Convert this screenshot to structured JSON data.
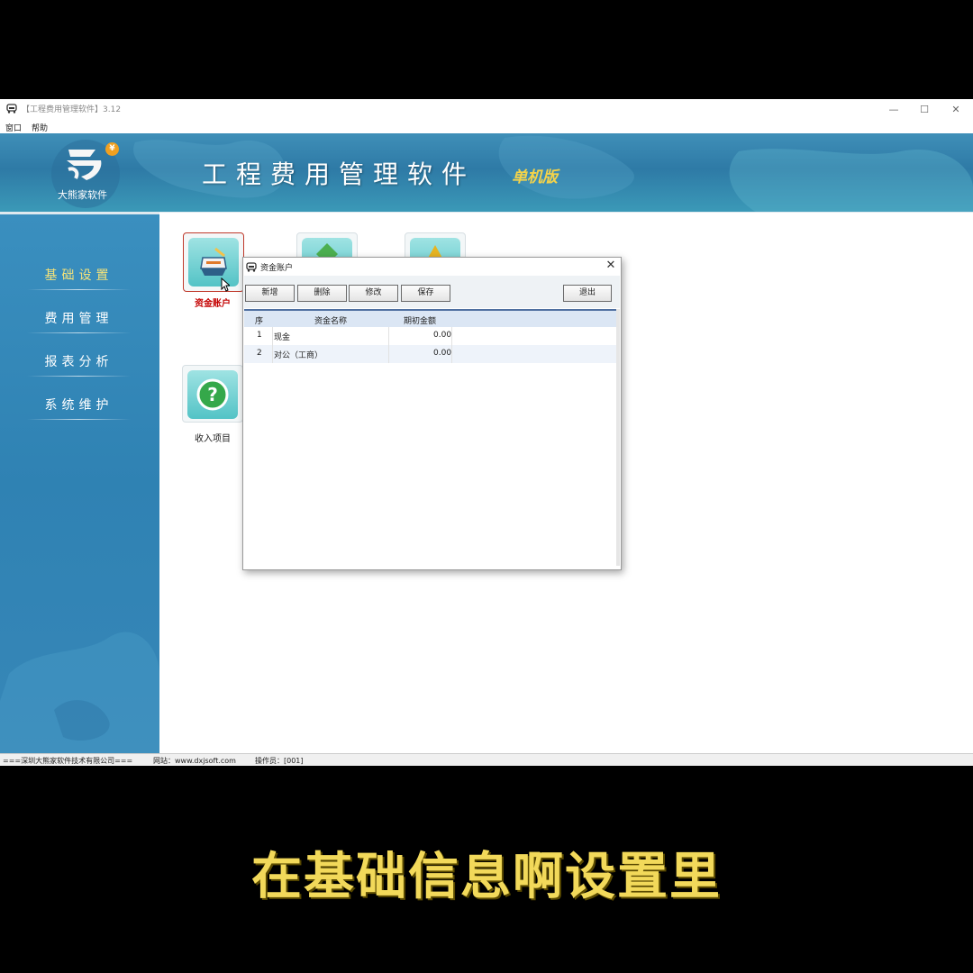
{
  "window": {
    "title": "【工程费用管理软件】3.12",
    "controls": {
      "minimize": "—",
      "maximize": "☐",
      "close": "✕"
    }
  },
  "menu": [
    "窗口",
    "帮助"
  ],
  "banner": {
    "logo_text": "大熊家软件",
    "logo_badge": "¥",
    "title": "工程费用管理软件",
    "edition": "单机版"
  },
  "sidebar": {
    "items": [
      {
        "label": "基础设置",
        "active": true
      },
      {
        "label": "费用管理",
        "active": false
      },
      {
        "label": "报表分析",
        "active": false
      },
      {
        "label": "系统维护",
        "active": false
      }
    ]
  },
  "tiles": [
    {
      "label": "资金账户",
      "icon": "account-icon",
      "selected": true
    },
    {
      "label": "",
      "icon": "green-diamond-icon",
      "selected": false
    },
    {
      "label": "",
      "icon": "warning-icon",
      "selected": false
    },
    {
      "label": "收入项目",
      "icon": "question-icon",
      "selected": false
    }
  ],
  "dialog": {
    "title": "资金账户",
    "buttons": {
      "add": "新增",
      "delete": "删除",
      "edit": "修改",
      "save": "保存",
      "exit": "退出"
    },
    "columns": [
      "序",
      "资金名称",
      "期初金额"
    ],
    "rows": [
      {
        "no": "1",
        "name": "现金",
        "amount": "0.00"
      },
      {
        "no": "2",
        "name": "对公（工商）",
        "amount": "0.00"
      }
    ]
  },
  "statusbar": {
    "company": "===深圳大熊家软件技术有限公司===",
    "website": "网站：www.dxjsoft.com",
    "operator": "操作员：[001]"
  },
  "subtitle": "在基础信息啊设置里",
  "colors": {
    "banner": "#2e7aa6",
    "sidebar": "#3a8fbf",
    "subtitle": "#f2d95a",
    "active_nav": "#f4e27a"
  }
}
